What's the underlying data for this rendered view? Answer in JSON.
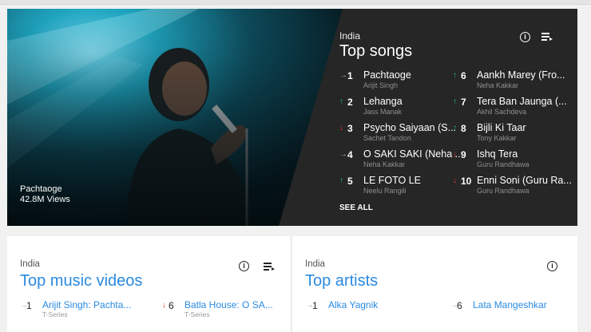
{
  "colors": {
    "accent": "#2a8ae0",
    "up": "#1db9a3",
    "down": "#e53935",
    "dark_bg": "#262626"
  },
  "hero": {
    "song": "Pachtaoge",
    "views": "42.8M Views"
  },
  "top_songs": {
    "country": "India",
    "title": "Top songs",
    "see_all": "SEE ALL",
    "items": [
      {
        "trend": "same",
        "arrow": "→",
        "rank": "1",
        "title": "Pachtaoge",
        "artist": "Arijit Singh"
      },
      {
        "trend": "up",
        "arrow": "↑",
        "rank": "2",
        "title": "Lehanga",
        "artist": "Jass Manak"
      },
      {
        "trend": "down",
        "arrow": "↓",
        "rank": "3",
        "title": "Psycho Saiyaan (S...",
        "artist": "Sachet Tandon"
      },
      {
        "trend": "same",
        "arrow": "→",
        "rank": "4",
        "title": "O SAKI SAKI (Neha ...",
        "artist": "Neha Kakkar"
      },
      {
        "trend": "up",
        "arrow": "↑",
        "rank": "5",
        "title": "LE FOTO LE",
        "artist": "Neelu Rangili"
      },
      {
        "trend": "up",
        "arrow": "↑",
        "rank": "6",
        "title": "Aankh Marey (Fro...",
        "artist": "Neha Kakkar"
      },
      {
        "trend": "up",
        "arrow": "↑",
        "rank": "7",
        "title": "Tera Ban Jaunga (...",
        "artist": "Akhil Sachdeva"
      },
      {
        "trend": "up",
        "arrow": "↑",
        "rank": "8",
        "title": "Bijli Ki Taar",
        "artist": "Tony Kakkar"
      },
      {
        "trend": "down",
        "arrow": "↓",
        "rank": "9",
        "title": "Ishq Tera",
        "artist": "Guru Randhawa"
      },
      {
        "trend": "down",
        "arrow": "↓",
        "rank": "10",
        "title": "Enni Soni (Guru Ra...",
        "artist": "Guru Randhawa"
      }
    ]
  },
  "top_videos": {
    "country": "India",
    "title": "Top music videos",
    "items": [
      {
        "trend": "same",
        "arrow": "→",
        "rank": "1",
        "title": "Arijit Singh: Pachta...",
        "artist": "T-Series"
      },
      {
        "trend": "down",
        "arrow": "↓",
        "rank": "6",
        "title": "Batla House: O SA...",
        "artist": "T-Series"
      }
    ]
  },
  "top_artists": {
    "country": "India",
    "title": "Top artists",
    "items": [
      {
        "trend": "same",
        "arrow": "→",
        "rank": "1",
        "title": "Alka Yagnik"
      },
      {
        "trend": "same",
        "arrow": "→",
        "rank": "6",
        "title": "Lata Mangeshkar"
      }
    ]
  }
}
